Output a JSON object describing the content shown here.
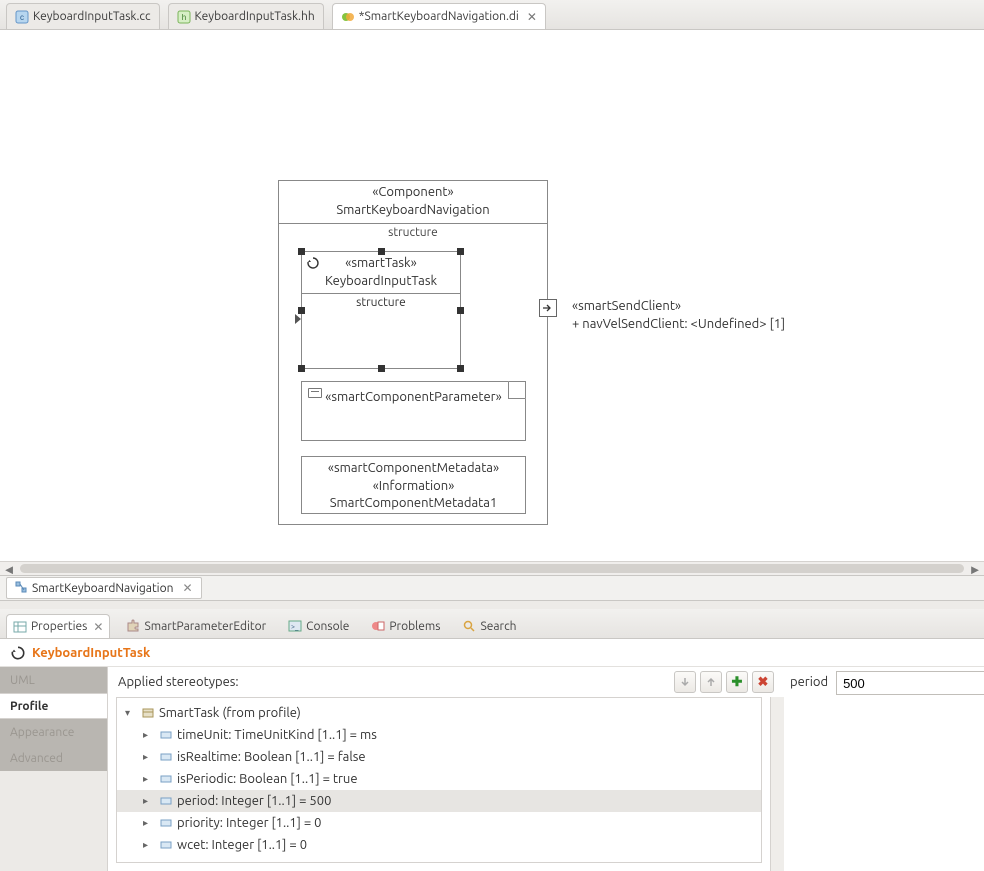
{
  "tabs": [
    {
      "label": "KeyboardInputTask.cc",
      "iconType": "c-file"
    },
    {
      "label": "KeyboardInputTask.hh",
      "iconType": "h-file"
    },
    {
      "label": "*SmartKeyboardNavigation.di",
      "iconType": "papyrus"
    }
  ],
  "diagram": {
    "component": {
      "stereotype": "«Component»",
      "name": "SmartKeyboardNavigation",
      "compartment": "structure"
    },
    "smartTask": {
      "stereotype": "«smartTask»",
      "name": "KeyboardInputTask",
      "compartment": "structure"
    },
    "paramNote": {
      "stereotype": "«smartComponentParameter»"
    },
    "metadata": {
      "stereotype1": "«smartComponentMetadata»",
      "stereotype2": "«Information»",
      "name": "SmartComponentMetadata1"
    },
    "port": {
      "stereotype": "«smartSendClient»",
      "signature": "+ navVelSendClient: <Undefined> [1]"
    }
  },
  "diagramTab": {
    "label": "SmartKeyboardNavigation"
  },
  "panelTabs": [
    {
      "label": "Properties",
      "iconType": "props"
    },
    {
      "label": "SmartParameterEditor",
      "iconType": "puzzle"
    },
    {
      "label": "Console",
      "iconType": "console"
    },
    {
      "label": "Problems",
      "iconType": "problems"
    },
    {
      "label": "Search",
      "iconType": "search"
    }
  ],
  "properties": {
    "title": "KeyboardInputTask",
    "categories": [
      "UML",
      "Profile",
      "Appearance",
      "Advanced"
    ],
    "stereotypesLabel": "Applied stereotypes:",
    "root": "SmartTask   (from profile)",
    "rows": [
      "timeUnit: TimeUnitKind [1..1] = ms",
      "isRealtime: Boolean [1..1] = false",
      "isPeriodic: Boolean [1..1] = true",
      "period: Integer [1..1] = 500",
      "priority: Integer [1..1] = 0",
      "wcet: Integer [1..1] = 0"
    ],
    "selectedIndex": 3,
    "valueLabel": "period",
    "value": "500"
  }
}
